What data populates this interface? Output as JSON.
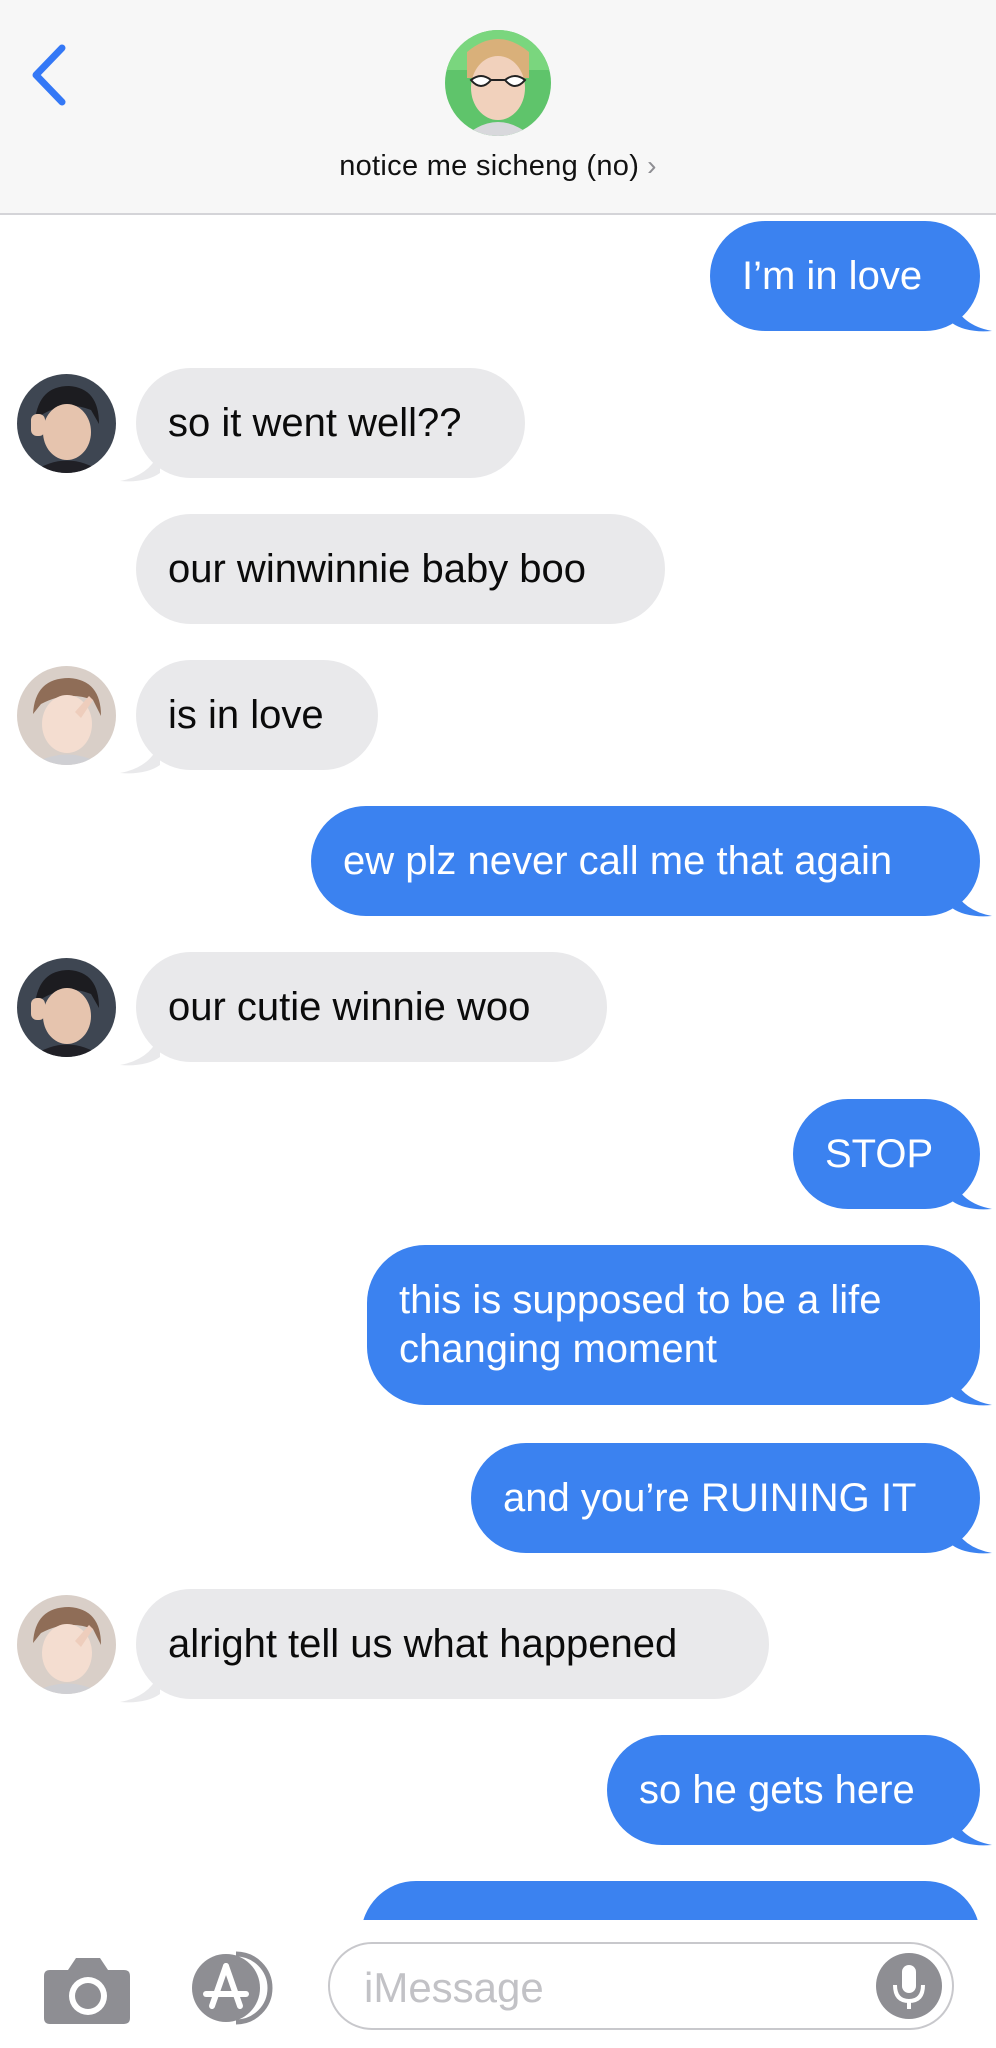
{
  "header": {
    "contact_name": "notice me sicheng (no)",
    "chevron": "›"
  },
  "messages": [
    {
      "id": 0,
      "direction": "out",
      "text": "I’m in love"
    },
    {
      "id": 1,
      "direction": "in",
      "sender": "friend-1",
      "text": "so it went well??"
    },
    {
      "id": 2,
      "direction": "in",
      "sender": "friend-1",
      "text": "our winwinnie baby boo"
    },
    {
      "id": 3,
      "direction": "in",
      "sender": "friend-2",
      "text": "is in love"
    },
    {
      "id": 4,
      "direction": "out",
      "text": "ew plz never call me that again"
    },
    {
      "id": 5,
      "direction": "in",
      "sender": "friend-1",
      "text": "our cutie winnie woo"
    },
    {
      "id": 6,
      "direction": "out",
      "text": "STOP"
    },
    {
      "id": 7,
      "direction": "out",
      "text": "this is supposed to be a life changing moment"
    },
    {
      "id": 8,
      "direction": "out",
      "text": "and you’re RUINING IT"
    },
    {
      "id": 9,
      "direction": "in",
      "sender": "friend-2",
      "text": "alright tell us what happened"
    },
    {
      "id": 10,
      "direction": "out",
      "text": "so he gets here"
    },
    {
      "id": 11,
      "direction": "out",
      "text": ""
    }
  ],
  "composer": {
    "placeholder": "iMessage"
  },
  "colors": {
    "outgoing_bubble": "#3b82f0",
    "incoming_bubble": "#e9e9eb",
    "accent": "#3478f6"
  },
  "icons": [
    "back-chevron-icon",
    "contact-avatar",
    "camera-icon",
    "app-store-icon",
    "microphone-icon"
  ]
}
